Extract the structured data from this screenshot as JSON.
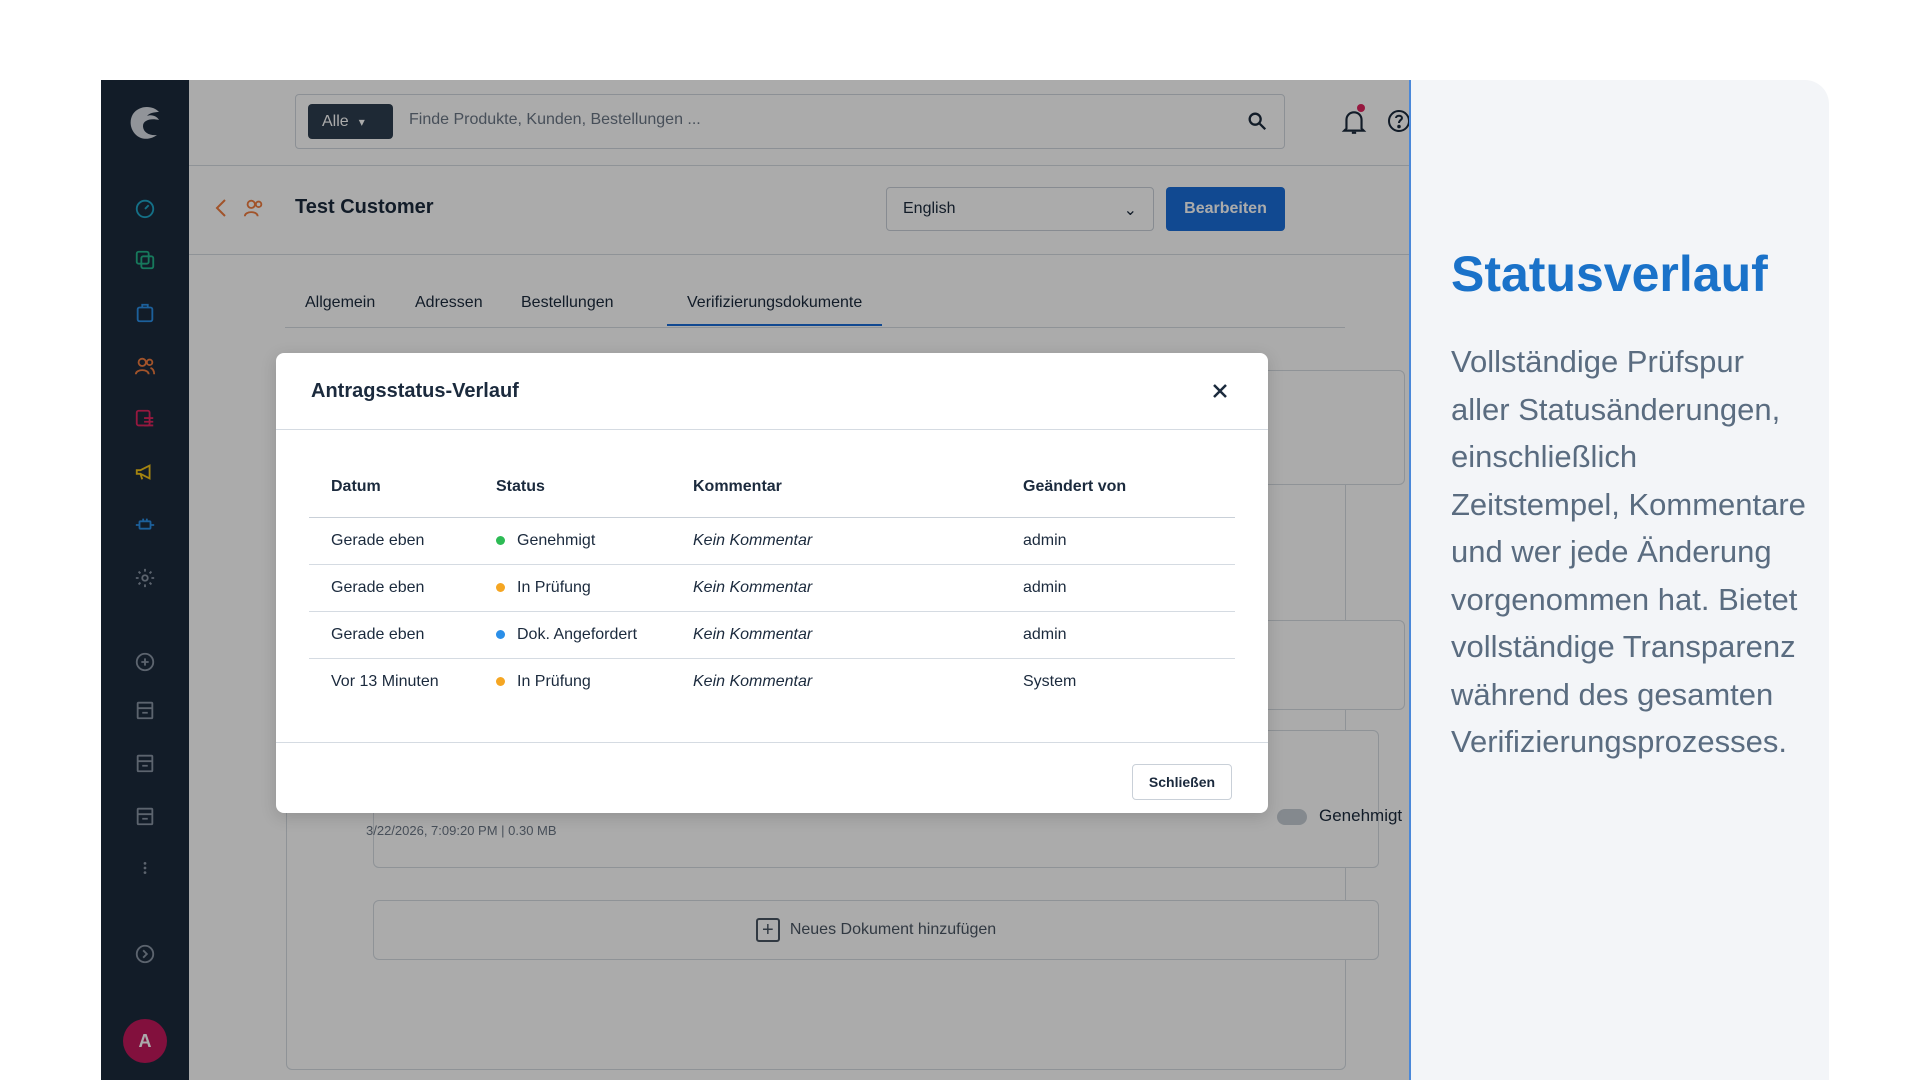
{
  "sidebar": {
    "logo": "shopware-logo",
    "icons": [
      "dashboard-icon",
      "catalogue-icon",
      "orders-icon",
      "customers-icon",
      "content-icon",
      "marketing-icon",
      "extensions-icon",
      "settings-icon",
      "add-channel-icon",
      "storefront-icon-1",
      "storefront-icon-2",
      "storefront-icon-3",
      "more-icon",
      "expand-icon"
    ],
    "avatar_initial": "A"
  },
  "topbar": {
    "filter_label": "Alle",
    "search_placeholder": "Finde Produkte, Kunden, Bestellungen ..."
  },
  "header": {
    "title": "Test Customer",
    "language": "English",
    "edit_label": "Bearbeiten"
  },
  "tabs": [
    {
      "label": "Allgemein"
    },
    {
      "label": "Adressen"
    },
    {
      "label": "Bestellungen"
    },
    {
      "label": "Verifizierungsdokumente",
      "active": true
    }
  ],
  "document": {
    "meta": "3/22/2026, 7:09:20 PM  |  0.30 MB",
    "status": "Genehmigt"
  },
  "add_document_label": "Neues Dokument hinzufügen",
  "modal": {
    "title": "Antragsstatus-Verlauf",
    "columns": [
      "Datum",
      "Status",
      "Kommentar",
      "Geändert von"
    ],
    "rows": [
      {
        "date": "Gerade eben",
        "status": "Genehmigt",
        "status_color": "#2dbb55",
        "comment": "Kein Kommentar",
        "changed_by": "admin"
      },
      {
        "date": "Gerade eben",
        "status": "In Prüfung",
        "status_color": "#f5a623",
        "comment": "Kein Kommentar",
        "changed_by": "admin"
      },
      {
        "date": "Gerade eben",
        "status": "Dok. Angefordert",
        "status_color": "#2b8fe8",
        "comment": "Kein Kommentar",
        "changed_by": "admin"
      },
      {
        "date": "Vor 13 Minuten",
        "status": "In Prüfung",
        "status_color": "#f5a623",
        "comment": "Kein Kommentar",
        "changed_by": "System"
      }
    ],
    "close_label": "Schließen"
  },
  "info_panel": {
    "title": "Statusverlauf",
    "text": "Vollständige Prüfspur aller Statusänderungen, einschließlich Zeitstempel, Kommentare und wer jede Änderung vorgenommen hat. Bietet vollständige Transparenz während des gesamten Verifizierungsprozesses."
  }
}
